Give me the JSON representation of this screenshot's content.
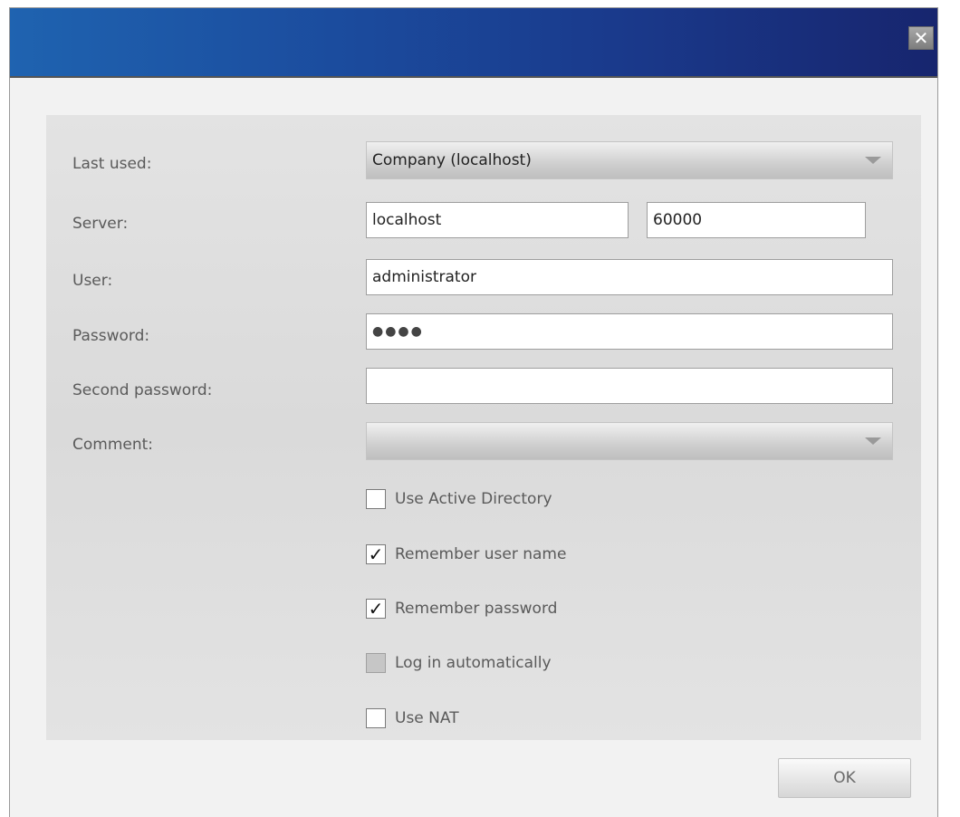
{
  "window": {
    "title": "",
    "close_glyph": "✕"
  },
  "form": {
    "last_used": {
      "label": "Last used:",
      "value": "Company (localhost)"
    },
    "server": {
      "label": "Server:",
      "host": "localhost",
      "port": "60000"
    },
    "user": {
      "label": "User:",
      "value": "administrator"
    },
    "password": {
      "label": "Password:",
      "value": "●●●●"
    },
    "second_password": {
      "label": "Second password:",
      "value": ""
    },
    "comment": {
      "label": "Comment:",
      "value": ""
    }
  },
  "options": [
    {
      "label": "Use Active Directory",
      "checked": false,
      "disabled": false
    },
    {
      "label": "Remember user name",
      "checked": true,
      "disabled": false
    },
    {
      "label": "Remember password",
      "checked": true,
      "disabled": false
    },
    {
      "label": "Log in automatically",
      "checked": false,
      "disabled": true
    },
    {
      "label": "Use NAT",
      "checked": false,
      "disabled": false
    }
  ],
  "footer": {
    "ok_label": "OK"
  },
  "check_glyph": "✓"
}
